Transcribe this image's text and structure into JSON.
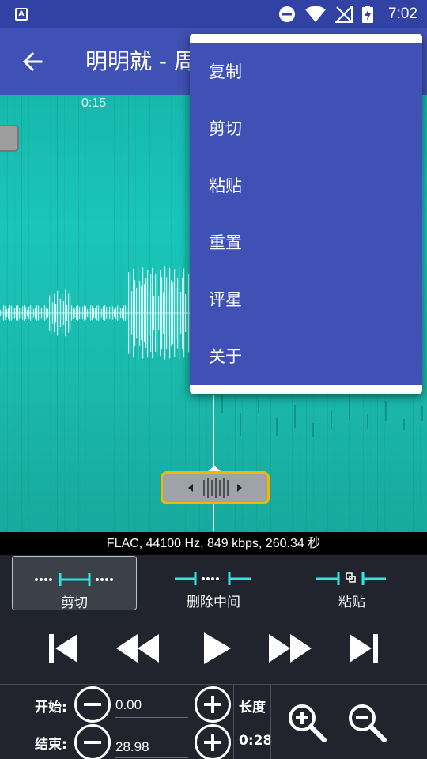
{
  "status_bar": {
    "time": "7:02",
    "icons": [
      "app-notification-icon",
      "do-not-disturb-icon",
      "wifi-icon",
      "no-signal-icon",
      "battery-charging-icon"
    ]
  },
  "app_bar": {
    "title": "明明就 - 周"
  },
  "waveform": {
    "time_marker": "0:15",
    "colors": {
      "background": "#1ab7aa",
      "wave": "#c8fbf6",
      "scrubber_border": "#f2b600"
    }
  },
  "menu": {
    "items": [
      "复制",
      "剪切",
      "粘贴",
      "重置",
      "评星",
      "关于"
    ]
  },
  "info": {
    "text": "FLAC, 44100 Hz, 849 kbps, 260.34 秒"
  },
  "modes": [
    {
      "label": "剪切",
      "icon": "trim-mode-icon",
      "active": true
    },
    {
      "label": "删除中间",
      "icon": "remove-middle-icon",
      "active": false
    },
    {
      "label": "粘贴",
      "icon": "paste-mode-icon",
      "active": false
    }
  ],
  "transport": [
    "skip-to-start-icon",
    "rewind-icon",
    "play-icon",
    "fast-forward-icon",
    "skip-to-end-icon"
  ],
  "edit": {
    "start_label": "开始:",
    "start_value": "0.00",
    "end_label": "结束:",
    "end_value": "28.98",
    "length_label": "长度",
    "length_value": "0:28"
  },
  "accent_color": "#3f51b5",
  "cyan_accent": "#2ee6e6"
}
